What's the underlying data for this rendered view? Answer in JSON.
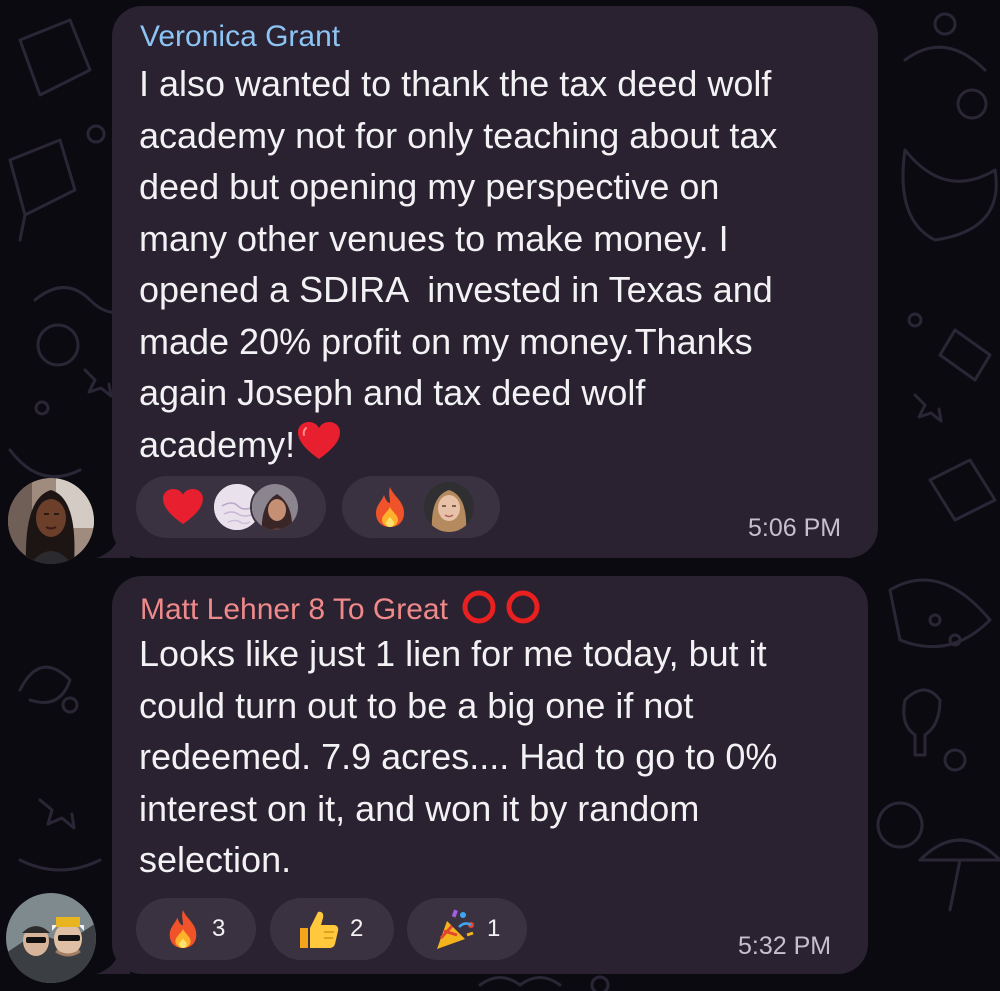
{
  "messages": [
    {
      "sender": "Veronica Grant",
      "text": "I also wanted to thank the tax deed wolf\nacademy not for only teaching about tax\ndeed but opening my perspective on\nmany other venues to make money. I\nopened a SDIRA  invested in Texas and\nmade 20% profit on my money.Thanks\nagain Joseph and tax deed wolf\nacademy!",
      "text_emoji": "heart-emoji",
      "time": "5:06 PM",
      "sender_color": "#8cc4f4",
      "reactions": [
        {
          "emoji": "red-heart",
          "reactors": [
            "reactor-avatar-pink-card",
            "reactor-avatar-woman-dark-hair"
          ]
        },
        {
          "emoji": "fire",
          "reactors": [
            "reactor-avatar-woman-blonde"
          ]
        }
      ]
    },
    {
      "sender": "Matt Lehner 8 To Great",
      "sender_badge": "red-double-circle",
      "text": "Looks like just 1 lien for me today, but it\ncould turn out to be a big one if not\nredeemed. 7.9 acres.... Had to go to 0%\ninterest on it, and won it by random\nselection.",
      "time": "5:32 PM",
      "sender_color": "#f08a8a",
      "reactions": [
        {
          "emoji": "fire",
          "count": "3"
        },
        {
          "emoji": "thumbs-up",
          "count": "2"
        },
        {
          "emoji": "party-popper",
          "count": "1"
        }
      ]
    }
  ],
  "colors": {
    "bubble": "#2a2131",
    "reaction_pill": "#3b3241",
    "background": "#0b0a10"
  }
}
